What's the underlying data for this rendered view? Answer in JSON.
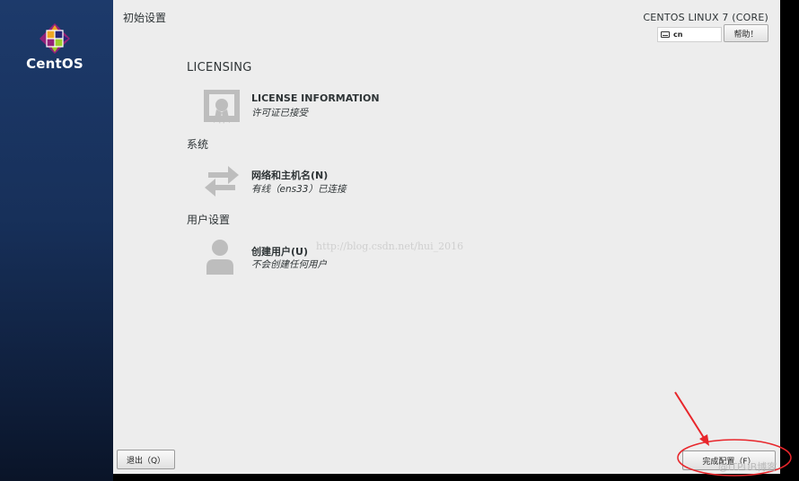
{
  "sidebar": {
    "logo_text": "CentOS"
  },
  "header": {
    "title": "初始设置",
    "product": "CENTOS LINUX 7 (CORE)",
    "keyboard": "cn",
    "help_label": "帮助！"
  },
  "sections": {
    "licensing": {
      "heading": "LICENSING",
      "spoke": {
        "title": "LICENSE INFORMATION",
        "status": "许可证已接受",
        "icon": "license-certificate-icon"
      }
    },
    "system": {
      "heading": "系统",
      "spoke": {
        "title": "网络和主机名(N)",
        "status": "有线（ens33）已连接",
        "icon": "network-arrows-icon"
      }
    },
    "user": {
      "heading": "用户设置",
      "spoke": {
        "title": "创建用户(U)",
        "status": "不会创建任何用户",
        "icon": "user-icon"
      }
    }
  },
  "footer": {
    "quit_label": "退出（Q）",
    "finish_label": "完成配置（F）"
  },
  "watermark": "http://blog.csdn.net/hui_2016",
  "credit": "@ITPUB博客",
  "colors": {
    "sidebar": "#17305a",
    "panel": "#ededed",
    "annotation": "#e8262b"
  }
}
